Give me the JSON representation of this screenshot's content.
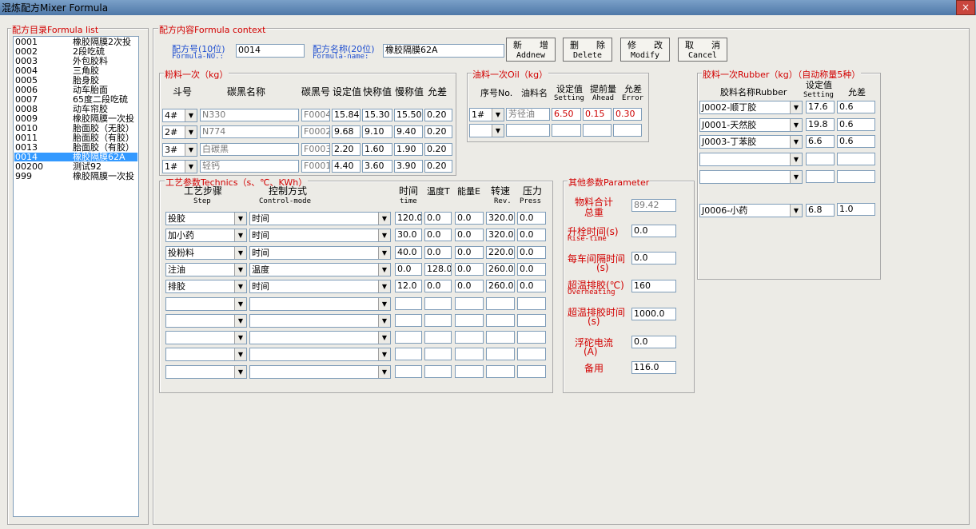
{
  "window": {
    "title": "混炼配方Mixer Formula",
    "close": "×"
  },
  "formula_list": {
    "legend": "配方目录Formula list",
    "items": [
      {
        "code": "0001",
        "name": "橡胶隔膜2次投"
      },
      {
        "code": "0002",
        "name": "2段吃硫"
      },
      {
        "code": "0003",
        "name": "外包胶料"
      },
      {
        "code": "0004",
        "name": "三角胶"
      },
      {
        "code": "0005",
        "name": "胎身胶"
      },
      {
        "code": "0006",
        "name": "动车胎面"
      },
      {
        "code": "0007",
        "name": "65度二段吃硫"
      },
      {
        "code": "0008",
        "name": "动车帘胶"
      },
      {
        "code": "0009",
        "name": "橡胶隔膜一次投"
      },
      {
        "code": "0010",
        "name": "胎面胶（无胶）"
      },
      {
        "code": "0011",
        "name": "胎面胶（有胶）"
      },
      {
        "code": "0013",
        "name": "胎面胶（有胶）"
      },
      {
        "code": "0014",
        "name": "橡胶隔膜62A"
      },
      {
        "code": "00200",
        "name": "测试92"
      },
      {
        "code": "999",
        "name": "橡胶隔膜一次投"
      }
    ],
    "selected_index": 12
  },
  "context": {
    "legend": "配方内容Formula context",
    "no_label": "配方号(10位)",
    "no_label_en": "Formula-NO.:",
    "no_value": "0014",
    "name_label": "配方名称(20位)",
    "name_label_en": "Formula-name:",
    "name_value": "橡胶隔膜62A"
  },
  "buttons": {
    "add": {
      "cn": "新　　增",
      "en": "Addnew"
    },
    "delete": {
      "cn": "删　　除",
      "en": "Delete"
    },
    "modify": {
      "cn": "修　　改",
      "en": "Modify"
    },
    "cancel": {
      "cn": "取　　消",
      "en": "Cancel"
    }
  },
  "powder": {
    "legend": "粉料一次（kg）",
    "headers": {
      "bin": "斗号",
      "name": "碳黑名称",
      "code": "碳黑号",
      "setting": "设定值",
      "fast": "快称值",
      "slow": "慢称值",
      "error": "允差"
    },
    "rows": [
      {
        "bin": "4#",
        "name": "N330",
        "code": "F0004",
        "setting": "15.84",
        "fast": "15.30",
        "slow": "15.50",
        "error": "0.20"
      },
      {
        "bin": "2#",
        "name": "N774",
        "code": "F0002",
        "setting": "9.68",
        "fast": "9.10",
        "slow": "9.40",
        "error": "0.20"
      },
      {
        "bin": "3#",
        "name": "白碳黑",
        "code": "F0003",
        "setting": "2.20",
        "fast": "1.60",
        "slow": "1.90",
        "error": "0.20"
      },
      {
        "bin": "1#",
        "name": "轻钙",
        "code": "F0001",
        "setting": "4.40",
        "fast": "3.60",
        "slow": "3.90",
        "error": "0.20"
      }
    ]
  },
  "oil": {
    "legend": "油料一次Oil（kg）",
    "headers": {
      "no": "序号No.",
      "name": "油料名",
      "setting": "设定值",
      "setting_en": "Setting",
      "ahead": "提前量",
      "ahead_en": "Ahead",
      "error": "允差",
      "error_en": "Error"
    },
    "rows": [
      {
        "no": "1#",
        "name": "芳径油",
        "setting": "6.50",
        "ahead": "0.15",
        "error": "0.30"
      },
      {
        "no": "",
        "name": "",
        "setting": "",
        "ahead": "",
        "error": ""
      }
    ]
  },
  "rubber": {
    "legend": "胶料一次Rubber（kg）（自动称量5种）",
    "headers": {
      "name": "胶料名称Rubber",
      "setting": "设定值",
      "setting_en": "Setting",
      "error": "允差"
    },
    "rows": [
      {
        "name": "J0002-顺丁胶",
        "setting": "17.6",
        "error": "0.6"
      },
      {
        "name": "J0001-天然胶",
        "setting": "19.8",
        "error": "0.6"
      },
      {
        "name": "J0003-丁苯胶",
        "setting": "6.6",
        "error": "0.6"
      },
      {
        "name": "",
        "setting": "",
        "error": ""
      },
      {
        "name": "",
        "setting": "",
        "error": ""
      }
    ],
    "small": {
      "name": "J0006-小药",
      "setting": "6.8",
      "error": "1.0"
    }
  },
  "tech": {
    "legend": "工艺参数Technics（s、℃、KWh）",
    "headers": {
      "step": "工艺步骤",
      "step_en": "Step",
      "mode": "控制方式",
      "mode_en": "Control-mode",
      "time": "时间",
      "time_en": "time",
      "temp": "温度T",
      "energy": "能量E",
      "rev": "转速",
      "rev_en": "Rev.",
      "press": "压力",
      "press_en": "Press"
    },
    "rows": [
      {
        "step": "投胶",
        "mode": "时间",
        "time": "120.0",
        "temp": "0.0",
        "energy": "0.0",
        "rev": "320.0",
        "press": "0.0"
      },
      {
        "step": "加小药",
        "mode": "时间",
        "time": "30.0",
        "temp": "0.0",
        "energy": "0.0",
        "rev": "320.0",
        "press": "0.0"
      },
      {
        "step": "投粉料",
        "mode": "时间",
        "time": "40.0",
        "temp": "0.0",
        "energy": "0.0",
        "rev": "220.0",
        "press": "0.0"
      },
      {
        "step": "注油",
        "mode": "温度",
        "time": "0.0",
        "temp": "128.0",
        "energy": "0.0",
        "rev": "260.0",
        "press": "0.0"
      },
      {
        "step": "排胶",
        "mode": "时间",
        "time": "12.0",
        "temp": "0.0",
        "energy": "0.0",
        "rev": "260.0",
        "press": "0.0"
      },
      {
        "step": "",
        "mode": "",
        "time": "",
        "temp": "",
        "energy": "",
        "rev": "",
        "press": ""
      },
      {
        "step": "",
        "mode": "",
        "time": "",
        "temp": "",
        "energy": "",
        "rev": "",
        "press": ""
      },
      {
        "step": "",
        "mode": "",
        "time": "",
        "temp": "",
        "energy": "",
        "rev": "",
        "press": ""
      },
      {
        "step": "",
        "mode": "",
        "time": "",
        "temp": "",
        "energy": "",
        "rev": "",
        "press": ""
      },
      {
        "step": "",
        "mode": "",
        "time": "",
        "temp": "",
        "energy": "",
        "rev": "",
        "press": ""
      }
    ]
  },
  "other": {
    "legend": "其他参数Parameter",
    "total_label": "物料合计",
    "total_label2": "总重",
    "total_value": "89.42",
    "rise_label": "升栓时间(s)",
    "rise_label_en": "Rise-time",
    "rise_value": "0.0",
    "interval_label": "每车间隔时间",
    "interval_label2": "(s)",
    "interval_value": "0.0",
    "overheat_label": "超温排胶(℃)",
    "overheat_label_en": "Overheating",
    "overheat_value": "160",
    "overtime_label": "超温排胶时间",
    "overtime_label2": "(s)",
    "overtime_value": "1000.0",
    "current_label": "浮砣电流",
    "current_label2": "(A)",
    "current_value": "0.0",
    "spare_label": "备用",
    "spare_value": "116.0"
  },
  "icons": {
    "dropdown": "▼"
  }
}
